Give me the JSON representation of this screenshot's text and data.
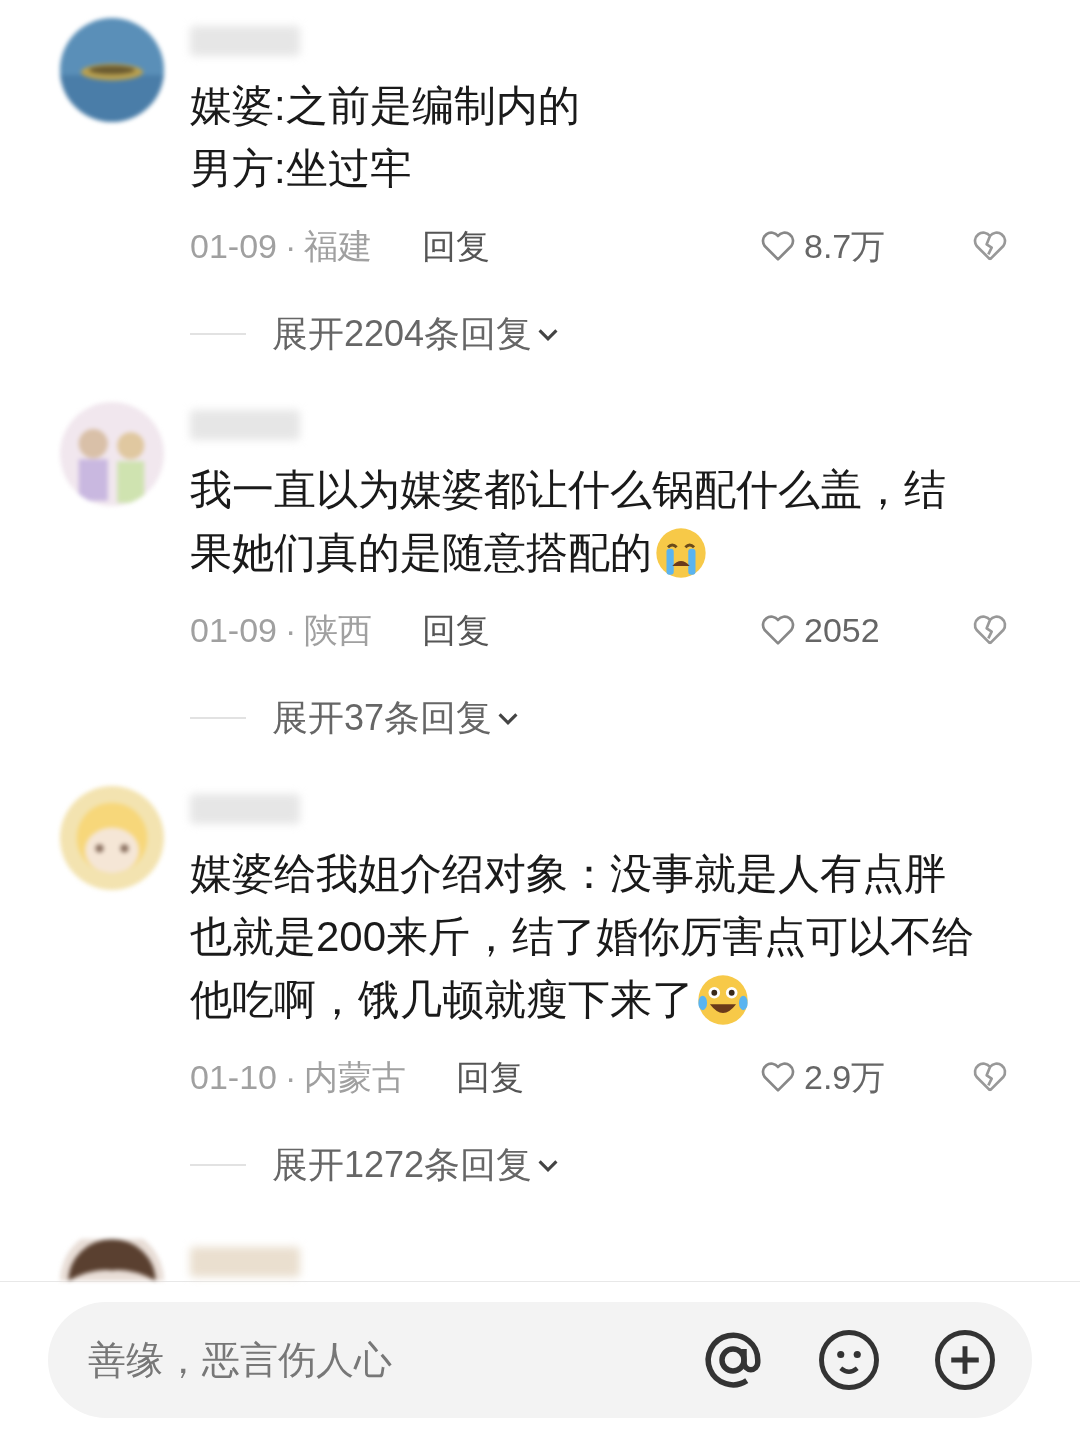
{
  "comments": [
    {
      "lines": [
        "媒婆:之前是编制内的",
        "男方:坐过牢"
      ],
      "date": "01-09",
      "separator": "·",
      "region": "福建",
      "reply": "回复",
      "likes": "8.7万",
      "expand": "展开2204条回复"
    },
    {
      "lines": [
        "我一直以为媒婆都让什么锅配什么盖，结",
        "果她们真的是随意搭配的"
      ],
      "emoji": {
        "kind": "crying"
      },
      "date": "01-09",
      "separator": "·",
      "region": "陕西",
      "reply": "回复",
      "likes": "2052",
      "expand": "展开37条回复"
    },
    {
      "lines": [
        "媒婆给我姐介绍对象：没事就是人有点胖",
        "也就是200来斤，结了婚你厉害点可以不给",
        "他吃啊，饿几顿就瘦下来了"
      ],
      "emoji": {
        "kind": "laughing-crying"
      },
      "date": "01-10",
      "separator": "·",
      "region": "内蒙古",
      "reply": "回复",
      "likes": "2.9万",
      "expand": "展开1272条回复"
    }
  ],
  "input": {
    "placeholder": "善缘，恶言伤人心"
  }
}
